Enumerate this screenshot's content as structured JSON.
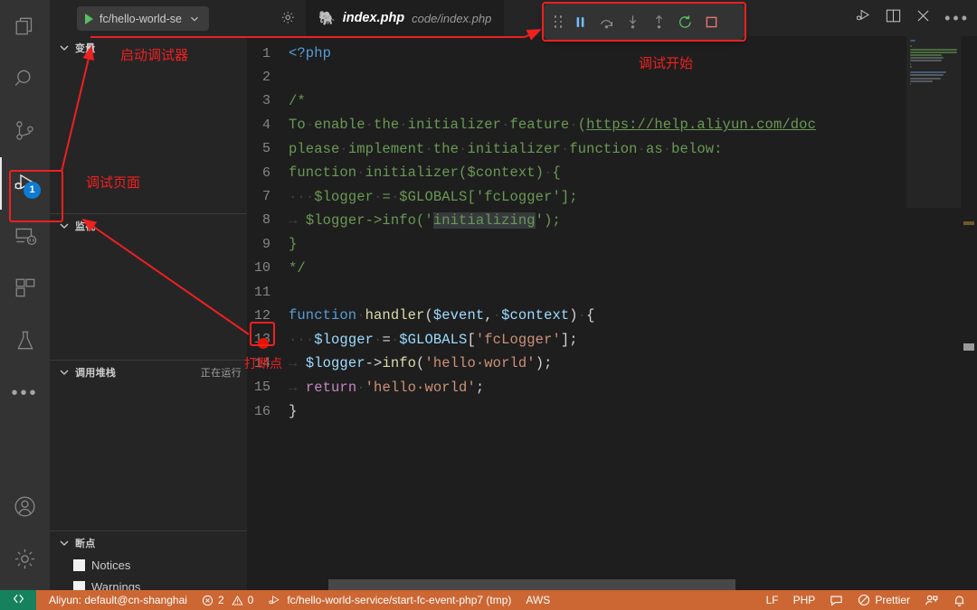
{
  "window": {
    "theme_bg": "#1e1e1e",
    "sidebar_bg": "#252526",
    "accent_debug": "#cc6633",
    "annotation_color": "#ef2020"
  },
  "activitybar": {
    "items": [
      {
        "name": "explorer",
        "icon": "files-icon"
      },
      {
        "name": "search",
        "icon": "search-icon"
      },
      {
        "name": "source-control",
        "icon": "source-control-icon"
      },
      {
        "name": "run-and-debug",
        "icon": "run-debug-icon",
        "badge": "1",
        "active": true
      },
      {
        "name": "remote-explorer",
        "icon": "remote-explorer-icon"
      },
      {
        "name": "extensions",
        "icon": "extensions-icon"
      },
      {
        "name": "testing",
        "icon": "beaker-icon"
      },
      {
        "name": "more",
        "icon": "ellipsis-icon"
      }
    ],
    "bottom_items": [
      {
        "name": "accounts",
        "icon": "account-icon"
      },
      {
        "name": "manage",
        "icon": "gear-icon"
      }
    ]
  },
  "toolbar": {
    "run_config": "fc/hello-world-se",
    "run_play_icon": "play-icon",
    "run_chevron_icon": "chevron-down-icon",
    "config_gear_icon": "debug-configure-icon",
    "titlebar_actions": [
      {
        "name": "run-and-debug-action",
        "icon": "run-debug-icon"
      },
      {
        "name": "split-editor",
        "icon": "split-editor-icon"
      },
      {
        "name": "close-editor",
        "icon": "close-icon"
      },
      {
        "name": "more-actions",
        "icon": "ellipsis-icon"
      }
    ]
  },
  "tab": {
    "file_icon": "php-elephant-icon",
    "filename": "index.php",
    "path": "code/index.php"
  },
  "debug_toolbar": {
    "buttons": [
      {
        "name": "drag-handle",
        "icon": "grip-icon",
        "label": ""
      },
      {
        "name": "pause-button",
        "icon": "pause-icon",
        "color": "#75beff"
      },
      {
        "name": "step-over-button",
        "icon": "step-over-icon",
        "color": "#8a8a8a"
      },
      {
        "name": "step-into-button",
        "icon": "step-into-icon",
        "color": "#8a8a8a"
      },
      {
        "name": "step-out-button",
        "icon": "step-out-icon",
        "color": "#8a8a8a"
      },
      {
        "name": "restart-button",
        "icon": "restart-icon",
        "color": "#56c062"
      },
      {
        "name": "stop-button",
        "icon": "stop-icon",
        "color": "#e57373"
      }
    ]
  },
  "sidebar": {
    "sections": [
      {
        "name": "variables",
        "title": "变量",
        "sub": ""
      },
      {
        "name": "watch",
        "title": "监视",
        "sub": ""
      },
      {
        "name": "call-stack",
        "title": "调用堆栈",
        "sub": "正在运行"
      },
      {
        "name": "breakpoints",
        "title": "断点",
        "sub": ""
      }
    ],
    "breakpoints": [
      {
        "label": "Notices",
        "checked": true
      },
      {
        "label": "Warnings",
        "checked": true
      }
    ]
  },
  "annotations": [
    {
      "name": "annotation-start-debugger",
      "text": "启动调试器"
    },
    {
      "name": "annotation-debug-page",
      "text": "调试页面"
    },
    {
      "name": "annotation-debug-started",
      "text": "调试开始"
    },
    {
      "name": "annotation-set-breakpoint",
      "text": "打断点"
    }
  ],
  "editor": {
    "breakpoint_line": 13,
    "first_line": 1,
    "lines": [
      {
        "n": "1",
        "tokens": [
          {
            "t": "<?php",
            "c": "c-kw"
          }
        ]
      },
      {
        "n": "2",
        "tokens": []
      },
      {
        "n": "3",
        "tokens": [
          {
            "t": "/*",
            "c": "c-cmt"
          }
        ]
      },
      {
        "n": "4",
        "tokens": [
          {
            "t": "To",
            "c": "c-cmt"
          },
          {
            "t": "·",
            "c": "ws"
          },
          {
            "t": "enable",
            "c": "c-cmt"
          },
          {
            "t": "·",
            "c": "ws"
          },
          {
            "t": "the",
            "c": "c-cmt"
          },
          {
            "t": "·",
            "c": "ws"
          },
          {
            "t": "initializer",
            "c": "c-cmt"
          },
          {
            "t": "·",
            "c": "ws"
          },
          {
            "t": "feature",
            "c": "c-cmt"
          },
          {
            "t": "·",
            "c": "ws"
          },
          {
            "t": "(",
            "c": "c-cmt"
          },
          {
            "t": "https://help.aliyun.com/doc",
            "c": "c-link"
          }
        ]
      },
      {
        "n": "5",
        "tokens": [
          {
            "t": "please",
            "c": "c-cmt"
          },
          {
            "t": "·",
            "c": "ws"
          },
          {
            "t": "implement",
            "c": "c-cmt"
          },
          {
            "t": "·",
            "c": "ws"
          },
          {
            "t": "the",
            "c": "c-cmt"
          },
          {
            "t": "·",
            "c": "ws"
          },
          {
            "t": "initializer",
            "c": "c-cmt"
          },
          {
            "t": "·",
            "c": "ws"
          },
          {
            "t": "function",
            "c": "c-cmt"
          },
          {
            "t": "·",
            "c": "ws"
          },
          {
            "t": "as",
            "c": "c-cmt"
          },
          {
            "t": "·",
            "c": "ws"
          },
          {
            "t": "below:",
            "c": "c-cmt"
          }
        ]
      },
      {
        "n": "6",
        "tokens": [
          {
            "t": "function",
            "c": "c-cmt"
          },
          {
            "t": "·",
            "c": "ws"
          },
          {
            "t": "initializer($context)",
            "c": "c-cmt"
          },
          {
            "t": "·",
            "c": "ws"
          },
          {
            "t": "{",
            "c": "c-cmt"
          }
        ]
      },
      {
        "n": "7",
        "tokens": [
          {
            "t": "·",
            "c": "guide"
          },
          {
            "t": "·",
            "c": "ws"
          },
          {
            "t": "·",
            "c": "ws"
          },
          {
            "t": "$logger",
            "c": "c-cmt"
          },
          {
            "t": "·",
            "c": "ws"
          },
          {
            "t": "=",
            "c": "c-cmt"
          },
          {
            "t": "·",
            "c": "ws"
          },
          {
            "t": "$GLOBALS['fcLogger'];",
            "c": "c-cmt"
          }
        ]
      },
      {
        "n": "8",
        "tokens": [
          {
            "t": "→",
            "c": "ws"
          },
          {
            "t": " ",
            "c": "ws"
          },
          {
            "t": "$logger->info('",
            "c": "c-cmt"
          },
          {
            "t": "initializing",
            "c": "c-cmt",
            "hl": true
          },
          {
            "t": "');",
            "c": "c-cmt"
          }
        ]
      },
      {
        "n": "9",
        "tokens": [
          {
            "t": "}",
            "c": "c-cmt"
          }
        ]
      },
      {
        "n": "10",
        "tokens": [
          {
            "t": "*/",
            "c": "c-cmt"
          }
        ]
      },
      {
        "n": "11",
        "tokens": []
      },
      {
        "n": "12",
        "tokens": [
          {
            "t": "function",
            "c": "c-kw"
          },
          {
            "t": "·",
            "c": "ws"
          },
          {
            "t": "handler",
            "c": "c-fn"
          },
          {
            "t": "(",
            "c": "c-pun"
          },
          {
            "t": "$event",
            "c": "c-var"
          },
          {
            "t": ",",
            "c": "c-pun"
          },
          {
            "t": "·",
            "c": "ws"
          },
          {
            "t": "$context",
            "c": "c-var"
          },
          {
            "t": ")",
            "c": "c-pun"
          },
          {
            "t": "·",
            "c": "ws"
          },
          {
            "t": "{",
            "c": "c-pun"
          }
        ]
      },
      {
        "n": "13",
        "tokens": [
          {
            "t": "·",
            "c": "guide"
          },
          {
            "t": "·",
            "c": "ws"
          },
          {
            "t": "·",
            "c": "ws"
          },
          {
            "t": "$logger",
            "c": "c-var"
          },
          {
            "t": "·",
            "c": "ws"
          },
          {
            "t": "=",
            "c": "c-pun"
          },
          {
            "t": "·",
            "c": "ws"
          },
          {
            "t": "$GLOBALS",
            "c": "c-var"
          },
          {
            "t": "[",
            "c": "c-pun"
          },
          {
            "t": "'fcLogger'",
            "c": "c-str"
          },
          {
            "t": "]",
            "c": "c-pun"
          },
          {
            "t": ";",
            "c": "c-pun"
          }
        ]
      },
      {
        "n": "14",
        "tokens": [
          {
            "t": "→",
            "c": "ws"
          },
          {
            "t": " ",
            "c": "ws"
          },
          {
            "t": "$logger",
            "c": "c-var"
          },
          {
            "t": "->",
            "c": "c-pun"
          },
          {
            "t": "info",
            "c": "c-fn"
          },
          {
            "t": "(",
            "c": "c-pun"
          },
          {
            "t": "'hello·world'",
            "c": "c-str"
          },
          {
            "t": ")",
            "c": "c-pun"
          },
          {
            "t": ";",
            "c": "c-pun"
          }
        ]
      },
      {
        "n": "15",
        "tokens": [
          {
            "t": "→",
            "c": "ws"
          },
          {
            "t": " ",
            "c": "ws"
          },
          {
            "t": "return",
            "c": "c-ctl"
          },
          {
            "t": "·",
            "c": "ws"
          },
          {
            "t": "'hello·world'",
            "c": "c-str"
          },
          {
            "t": ";",
            "c": "c-pun"
          }
        ]
      },
      {
        "n": "16",
        "tokens": [
          {
            "t": "}",
            "c": "c-pun"
          }
        ]
      }
    ]
  },
  "statusbar": {
    "remote_icon": "remote-window-icon",
    "left_items": [
      {
        "name": "status-aliyun-account",
        "text": "Aliyun: default@cn-shanghai",
        "icon": ""
      },
      {
        "name": "status-problems",
        "text": "2",
        "text2": "0",
        "icon": "error-icon",
        "icon2": "warning-icon"
      },
      {
        "name": "status-debug-target",
        "text": "fc/hello-world-service/start-fc-event-php7 (tmp)",
        "icon": "run-debug-icon"
      },
      {
        "name": "status-aws-profile",
        "text": "AWS",
        "icon": ""
      }
    ],
    "right_items": [
      {
        "name": "status-eol",
        "text": "LF",
        "icon": ""
      },
      {
        "name": "status-language-mode",
        "text": "PHP",
        "icon": ""
      },
      {
        "name": "status-feedback",
        "text": "",
        "icon": "feedback-icon"
      },
      {
        "name": "status-prettier",
        "text": "Prettier",
        "icon": "prettier-blocked-icon"
      },
      {
        "name": "status-live-share",
        "text": "",
        "icon": "live-share-icon"
      },
      {
        "name": "status-notifications",
        "text": "",
        "icon": "bell-icon"
      }
    ]
  }
}
